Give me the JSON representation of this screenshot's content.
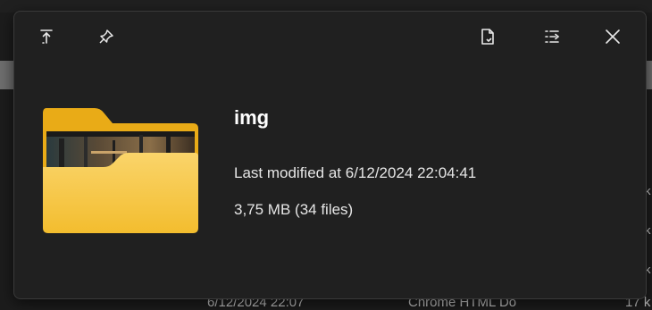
{
  "background": {
    "right_column": [
      "k",
      "k",
      "k"
    ],
    "bottom_row": [
      "6/12/2024 22:07",
      "Chrome HTML Do",
      "17 k"
    ]
  },
  "toolbar": {
    "left_icons": [
      "pin-on-top-icon",
      "pin-icon"
    ],
    "right_icons": [
      "open-file-icon",
      "list-details-icon",
      "close-icon"
    ]
  },
  "preview": {
    "name": "img",
    "modified": "Last modified at 6/12/2024 22:04:41",
    "size": "3,75 MB (34 files)"
  },
  "colors": {
    "popup_bg": "#202020",
    "folder_front": "#f7c648",
    "folder_back": "#e9ab17",
    "text": "#e6e6e6"
  }
}
